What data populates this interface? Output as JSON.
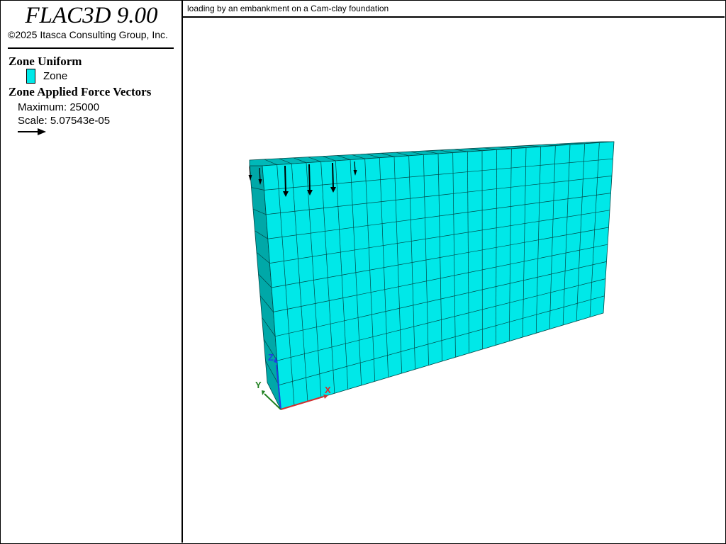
{
  "app": {
    "title": "FLAC3D 9.00",
    "copyright": "©2025 Itasca Consulting Group, Inc."
  },
  "legend": {
    "zone_uniform_title": "Zone Uniform",
    "zone_label": "Zone",
    "zone_color": "#00e8e8",
    "force_vectors_title": "Zone Applied Force Vectors",
    "maximum": "Maximum: 25000",
    "scale": "Scale: 5.07543e-05"
  },
  "plot": {
    "title": "loading by an embankment on a Cam-clay foundation",
    "axes": {
      "x": "X",
      "y": "Y",
      "z": "Z"
    },
    "colors": {
      "face": "#00e8e8",
      "side": "#00a8a8",
      "top": "#00b8b8",
      "grid": "#004848"
    }
  }
}
